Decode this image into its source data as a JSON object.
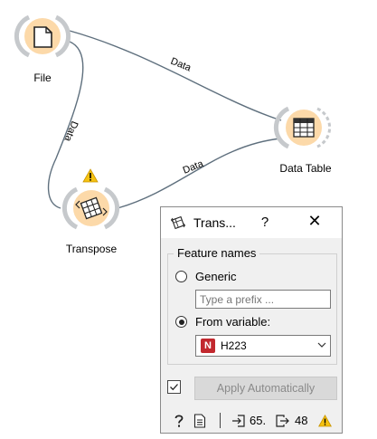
{
  "workflow": {
    "nodes": {
      "file": {
        "label": "File",
        "icon": "file-icon"
      },
      "data_table": {
        "label": "Data Table",
        "icon": "table-icon"
      },
      "transpose": {
        "label": "Transpose",
        "icon": "transpose-icon",
        "warning": true
      }
    },
    "edges": {
      "file_to_table": "Data",
      "file_to_transpose": "Data",
      "transpose_to_table": "Data"
    }
  },
  "dialog": {
    "title": "Trans...",
    "help": "?",
    "close": "✕",
    "feature_names": {
      "group_title": "Feature names",
      "option_generic": "Generic",
      "prefix_placeholder": "Type a prefix ...",
      "option_from_variable": "From variable:",
      "selected_option": "from-variable",
      "variable_icon_letter": "N",
      "variable_value": "H223"
    },
    "apply": {
      "checked": true,
      "label": "Apply Automatically"
    },
    "status": {
      "input_count": "65.",
      "output_count": "48"
    }
  },
  "colors": {
    "node_fill": "#fcd9a9",
    "node_ring": "#c6c9cc",
    "edge": "#5e6f7d",
    "warning": "#f5c211",
    "variable_icon": "#c2282e"
  }
}
